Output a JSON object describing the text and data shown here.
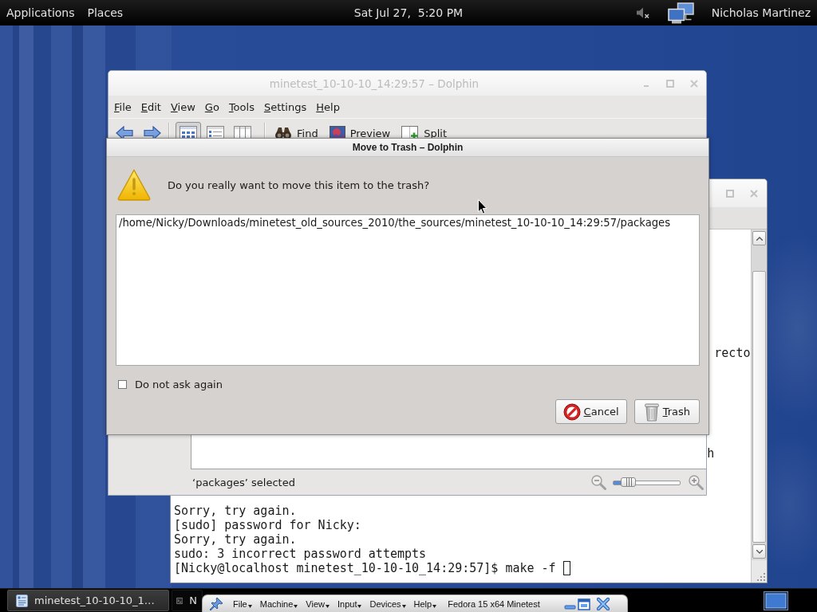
{
  "top_panel": {
    "menus": [
      "Applications",
      "Places"
    ],
    "clock": "Sat Jul 27,  5:20 PM",
    "user": "Nicholas Martinez"
  },
  "terminal": {
    "fragments": [
      "recto",
      "h"
    ],
    "lines": [
      "Sorry, try again.",
      "[sudo] password for Nicky:",
      "Sorry, try again.",
      "sudo: 3 incorrect password attempts",
      "[Nicky@localhost minetest_10-10-10_14:29:57]$ make -f"
    ]
  },
  "dolphin": {
    "title": "minetest_10-10-10_14:29:57 – Dolphin",
    "menu": [
      "File",
      "Edit",
      "View",
      "Go",
      "Tools",
      "Settings",
      "Help"
    ],
    "view_modes": [
      {
        "selected": true
      },
      {
        "selected": false
      },
      {
        "selected": false
      }
    ],
    "actions": [
      "Find",
      "Preview",
      "Split"
    ],
    "status": "‘packages’ selected",
    "zoom": {
      "level": 0.15
    }
  },
  "dialog": {
    "title": "Move to Trash – Dolphin",
    "message": "Do you really want to move this item to the trash?",
    "items": [
      "/home/Nicky/Downloads/minetest_old_sources_2010/the_sources/minetest_10-10-10_14:29:57/packages"
    ],
    "dont_ask": {
      "label": "Do not ask again",
      "checked": false
    },
    "buttons": [
      {
        "kind": "cancel",
        "label": "Cancel"
      },
      {
        "kind": "trash",
        "label": "Trash"
      }
    ]
  },
  "taskbar": {
    "tasks": [
      {
        "label": "minetest_10-10-10_1…",
        "selected": true
      },
      {
        "label": "N",
        "selected": false
      }
    ]
  },
  "vm_bar": {
    "menus": [
      "File",
      "Machine",
      "View",
      "Input",
      "Devices",
      "Help"
    ],
    "title": "Fedora 15 x64 Minetest"
  }
}
